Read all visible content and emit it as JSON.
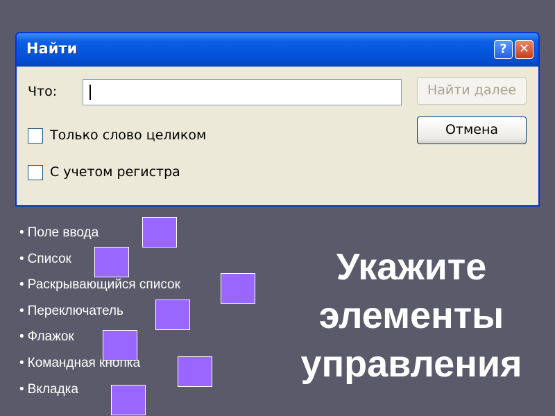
{
  "dialog": {
    "title": "Найти",
    "help_label": "?",
    "close_label": "✕",
    "find_what_label": "Что:",
    "find_what_value": "",
    "find_next_label": "Найти далее",
    "cancel_label": "Отмена",
    "checkbox_whole_word_label": "Только слово целиком",
    "checkbox_whole_word_checked": false,
    "checkbox_match_case_label": "С учетом регистра",
    "checkbox_match_case_checked": false
  },
  "bullet_char": "•",
  "terms": [
    {
      "label": "Поле ввода"
    },
    {
      "label": "Список"
    },
    {
      "label": "Раскрывающийся список"
    },
    {
      "label": "Переключатель"
    },
    {
      "label": "Флажок"
    },
    {
      "label": "Командная кнопка"
    },
    {
      "label": "Вкладка"
    }
  ],
  "heading": {
    "line1": "Укажите",
    "line2": "элементы",
    "line3": "управления"
  },
  "colors": {
    "background": "#5a5a6a",
    "answer_box": "#9966ff",
    "dialog_body": "#ece9d8",
    "title_bar": "#0452d8"
  }
}
